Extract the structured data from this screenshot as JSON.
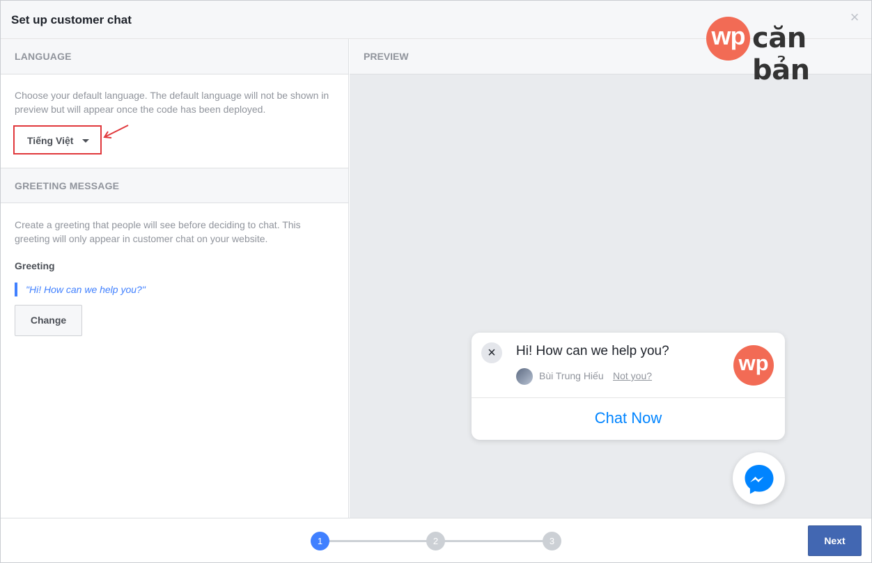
{
  "header": {
    "title": "Set up customer chat",
    "close": "×"
  },
  "logo": {
    "mark": "wp",
    "text": "căn bản"
  },
  "language": {
    "heading": "LANGUAGE",
    "description": "Choose your default language. The default language will not be shown in preview but will appear once the code has been deployed.",
    "selected": "Tiếng Việt"
  },
  "greeting": {
    "heading": "GREETING MESSAGE",
    "description": "Create a greeting that people will see before deciding to chat. This greeting will only appear in customer chat on your website.",
    "label": "Greeting",
    "text": "\"Hi! How can we help you?\"",
    "change_label": "Change"
  },
  "preview": {
    "heading": "PREVIEW",
    "message": "Hi! How can we help you?",
    "user_name": "Bùi Trung Hiếu",
    "not_you": "Not you?",
    "logo_mark": "wp",
    "chat_now": "Chat Now",
    "close": "×"
  },
  "footer": {
    "steps": [
      "1",
      "2",
      "3"
    ],
    "active_step": 1,
    "next_label": "Next"
  },
  "colors": {
    "accent": "#4080ff",
    "brand_orange": "#f26b55",
    "messenger_blue": "#0084ff",
    "next_button": "#4267b2",
    "highlight_red": "#e0373b"
  }
}
